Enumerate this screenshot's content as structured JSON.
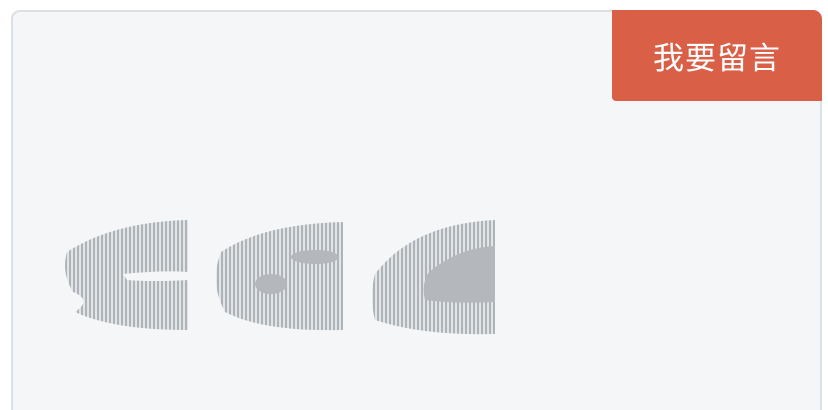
{
  "comment_box": {
    "button_label": "我要留言",
    "button_color": "#d95f47",
    "background_color": "#f4f6f8"
  },
  "empty_state": {
    "icon": "blurred-placeholder-icon",
    "icon_color": "#b4b8bc"
  }
}
